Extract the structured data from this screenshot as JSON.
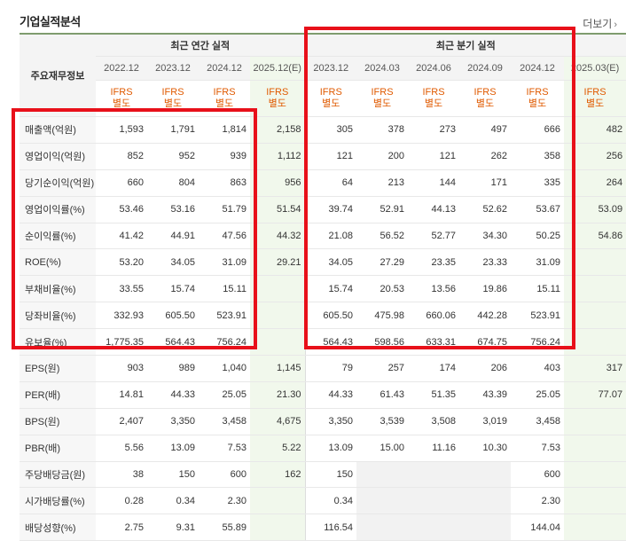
{
  "header": {
    "title": "기업실적분석",
    "more": "더보기"
  },
  "table": {
    "row_header": "주요재무정보",
    "group_annual": "최근 연간 실적",
    "group_quarter": "최근 분기 실적",
    "periods": [
      "2022.12",
      "2023.12",
      "2024.12",
      "2025.12(E)",
      "2023.12",
      "2024.03",
      "2024.06",
      "2024.09",
      "2024.12",
      "2025.03(E)"
    ],
    "ifrs": [
      "IFRS",
      "IFRS",
      "IFRS",
      "IFRS",
      "IFRS",
      "IFRS",
      "IFRS",
      "IFRS",
      "IFRS",
      "IFRS"
    ],
    "basis": [
      "별도",
      "별도",
      "별도",
      "별도",
      "별도",
      "별도",
      "별도",
      "별도",
      "별도",
      "별도"
    ],
    "rows": [
      {
        "label": "매출액(억원)",
        "values": [
          "1,593",
          "1,791",
          "1,814",
          "2,158",
          "305",
          "378",
          "273",
          "497",
          "666",
          "482"
        ]
      },
      {
        "label": "영업이익(억원)",
        "values": [
          "852",
          "952",
          "939",
          "1,112",
          "121",
          "200",
          "121",
          "262",
          "358",
          "256"
        ]
      },
      {
        "label": "당기순이익(억원)",
        "values": [
          "660",
          "804",
          "863",
          "956",
          "64",
          "213",
          "144",
          "171",
          "335",
          "264"
        ]
      },
      {
        "label": "영업이익률(%)",
        "values": [
          "53.46",
          "53.16",
          "51.79",
          "51.54",
          "39.74",
          "52.91",
          "44.13",
          "52.62",
          "53.67",
          "53.09"
        ]
      },
      {
        "label": "순이익률(%)",
        "values": [
          "41.42",
          "44.91",
          "47.56",
          "44.32",
          "21.08",
          "56.52",
          "52.77",
          "34.30",
          "50.25",
          "54.86"
        ]
      },
      {
        "label": "ROE(%)",
        "values": [
          "53.20",
          "34.05",
          "31.09",
          "29.21",
          "34.05",
          "27.29",
          "23.35",
          "23.33",
          "31.09",
          ""
        ]
      },
      {
        "label": "부채비율(%)",
        "values": [
          "33.55",
          "15.74",
          "15.11",
          "",
          "15.74",
          "20.53",
          "13.56",
          "19.86",
          "15.11",
          ""
        ]
      },
      {
        "label": "당좌비율(%)",
        "values": [
          "332.93",
          "605.50",
          "523.91",
          "",
          "605.50",
          "475.98",
          "660.06",
          "442.28",
          "523.91",
          ""
        ]
      },
      {
        "label": "유보율(%)",
        "values": [
          "1,775.35",
          "564.43",
          "756.24",
          "",
          "564.43",
          "598.56",
          "633.31",
          "674.75",
          "756.24",
          ""
        ]
      },
      {
        "label": "EPS(원)",
        "values": [
          "903",
          "989",
          "1,040",
          "1,145",
          "79",
          "257",
          "174",
          "206",
          "403",
          "317"
        ]
      },
      {
        "label": "PER(배)",
        "values": [
          "14.81",
          "44.33",
          "25.05",
          "21.30",
          "44.33",
          "61.43",
          "51.35",
          "43.39",
          "25.05",
          "77.07"
        ]
      },
      {
        "label": "BPS(원)",
        "values": [
          "2,407",
          "3,350",
          "3,458",
          "4,675",
          "3,350",
          "3,539",
          "3,508",
          "3,019",
          "3,458",
          ""
        ]
      },
      {
        "label": "PBR(배)",
        "values": [
          "5.56",
          "13.09",
          "7.53",
          "5.22",
          "13.09",
          "15.00",
          "11.16",
          "10.30",
          "7.53",
          ""
        ]
      },
      {
        "label": "주당배당금(원)",
        "values": [
          "38",
          "150",
          "600",
          "162",
          "150",
          "",
          "",
          "",
          "600",
          ""
        ]
      },
      {
        "label": "시가배당률(%)",
        "values": [
          "0.28",
          "0.34",
          "2.30",
          "",
          "0.34",
          "",
          "",
          "",
          "2.30",
          ""
        ]
      },
      {
        "label": "배당성향(%)",
        "values": [
          "2.75",
          "9.31",
          "55.89",
          "",
          "116.54",
          "",
          "",
          "",
          "144.04",
          ""
        ]
      }
    ]
  },
  "highlight_color": "#e8101a"
}
